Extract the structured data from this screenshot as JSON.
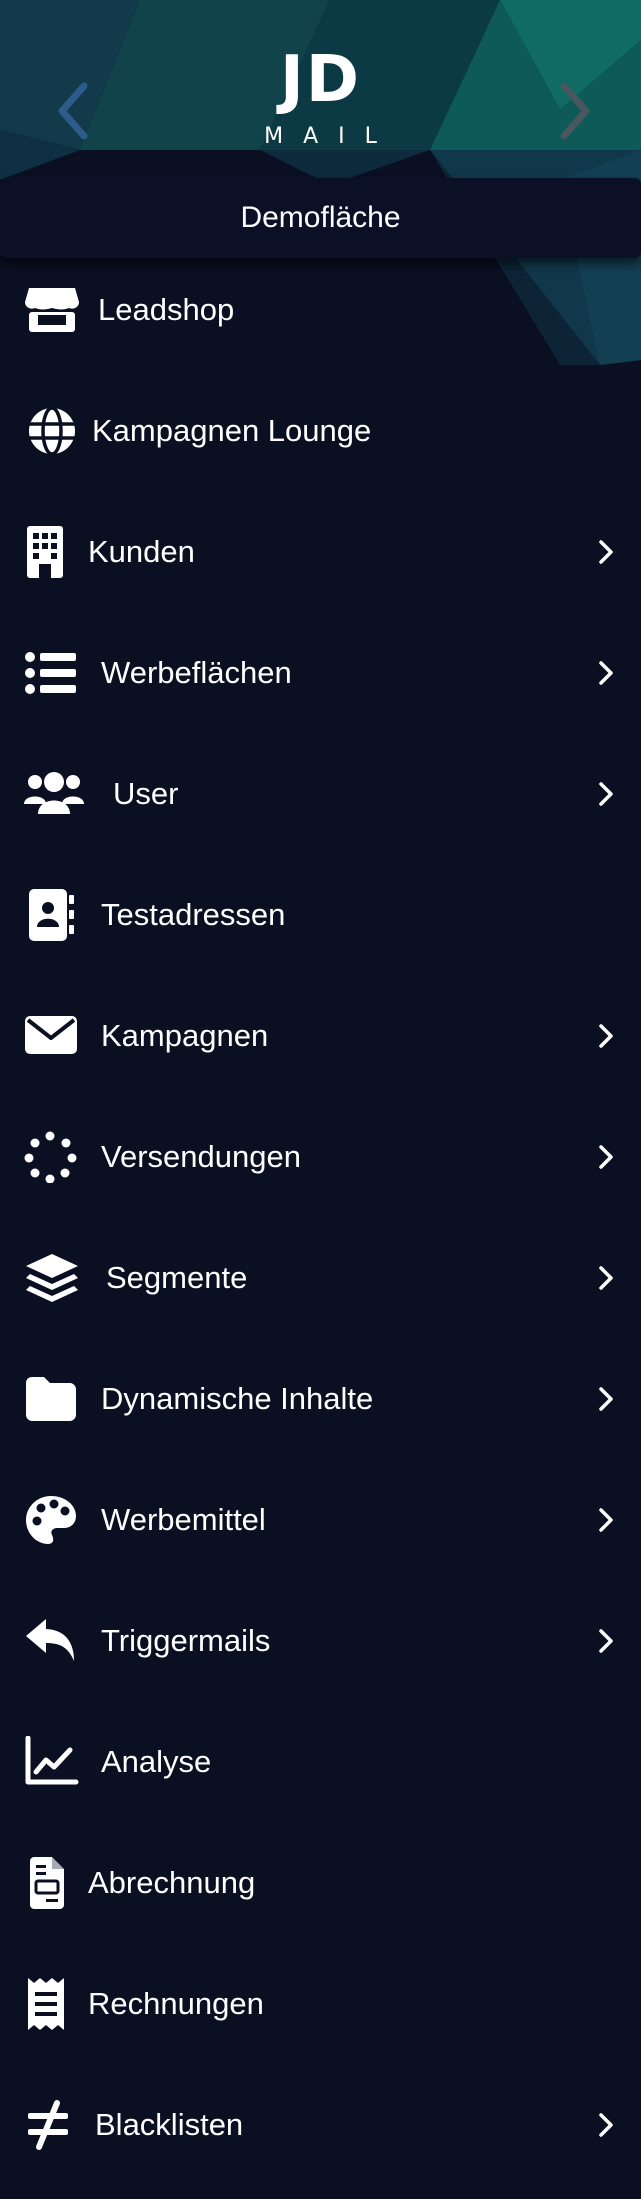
{
  "header": {
    "logo_mark": "JD",
    "logo_sub": "MAIL",
    "surface_label": "Demofläche",
    "colors": {
      "background": "#0a0f22",
      "teal": "#0f6b63",
      "prev_arrow": "#2d5c8a",
      "next_arrow": "#4a5660"
    }
  },
  "menu": {
    "items": [
      {
        "label": "Leadshop",
        "icon": "store-icon",
        "has_submenu": false
      },
      {
        "label": "Kampagnen Lounge",
        "icon": "globe-icon",
        "has_submenu": false
      },
      {
        "label": "Kunden",
        "icon": "building-icon",
        "has_submenu": true
      },
      {
        "label": "Werbeflächen",
        "icon": "list-icon",
        "has_submenu": true
      },
      {
        "label": "User",
        "icon": "users-icon",
        "has_submenu": true
      },
      {
        "label": "Testadressen",
        "icon": "address-book-icon",
        "has_submenu": false
      },
      {
        "label": "Kampagnen",
        "icon": "envelope-icon",
        "has_submenu": true
      },
      {
        "label": "Versendungen",
        "icon": "spinner-icon",
        "has_submenu": true
      },
      {
        "label": "Segmente",
        "icon": "layers-icon",
        "has_submenu": true
      },
      {
        "label": "Dynamische Inhalte",
        "icon": "folder-icon",
        "has_submenu": true
      },
      {
        "label": "Werbemittel",
        "icon": "palette-icon",
        "has_submenu": true
      },
      {
        "label": "Triggermails",
        "icon": "reply-icon",
        "has_submenu": true
      },
      {
        "label": "Analyse",
        "icon": "chart-line-icon",
        "has_submenu": false
      },
      {
        "label": "Abrechnung",
        "icon": "invoice-icon",
        "has_submenu": false
      },
      {
        "label": "Rechnungen",
        "icon": "receipt-icon",
        "has_submenu": false
      },
      {
        "label": "Blacklisten",
        "icon": "not-equal-icon",
        "has_submenu": true
      }
    ]
  }
}
